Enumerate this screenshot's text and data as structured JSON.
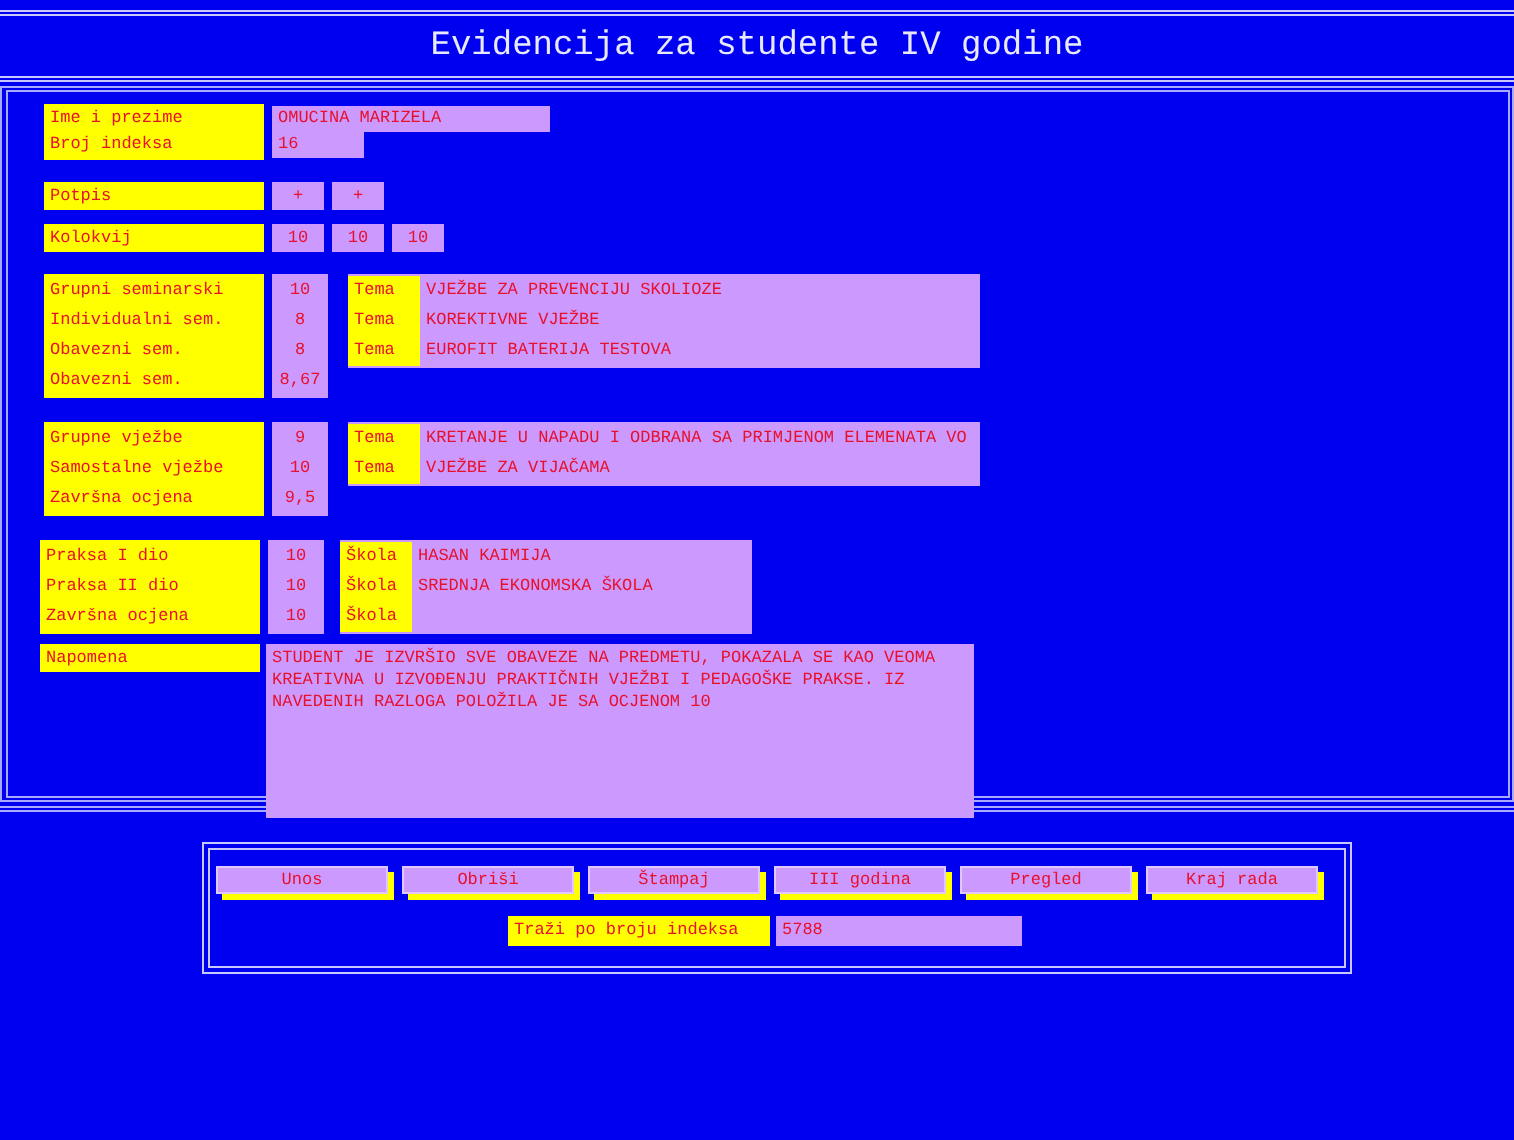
{
  "window": {
    "title": "Evidencija za studente IV godine"
  },
  "student": {
    "name_label": "Ime i prezime",
    "name": "OMUCINA MARIZELA",
    "index_label": "Broj indeksa",
    "index": "16"
  },
  "signature": {
    "label": "Potpis",
    "values": [
      "+",
      "+"
    ]
  },
  "colloquium": {
    "label": "Kolokvij",
    "values": [
      "10",
      "10",
      "10"
    ]
  },
  "seminars": {
    "rows": [
      {
        "label": "Grupni seminarski",
        "value": "10"
      },
      {
        "label": "Individualni sem.",
        "value": "8"
      },
      {
        "label": "Obavezni sem.",
        "value": "8"
      },
      {
        "label": "Obavezni sem.",
        "value": "8,67"
      }
    ],
    "topics": [
      {
        "label": "Tema",
        "value": "VJEŽBE ZA PREVENCIJU SKOLIOZE"
      },
      {
        "label": "Tema",
        "value": "KOREKTIVNE VJEŽBE"
      },
      {
        "label": "Tema",
        "value": "EUROFIT BATERIJA TESTOVA"
      }
    ]
  },
  "exercises": {
    "rows": [
      {
        "label": "Grupne vježbe",
        "value": "9"
      },
      {
        "label": "Samostalne vježbe",
        "value": "10"
      },
      {
        "label": "Završna ocjena",
        "value": "9,5"
      }
    ],
    "topics": [
      {
        "label": "Tema",
        "value": "KRETANJE U NAPADU I ODBRANA SA PRIMJENOM ELEMENATA VO"
      },
      {
        "label": "Tema",
        "value": "VJEŽBE ZA VIJAČAMA"
      }
    ]
  },
  "practice": {
    "rows": [
      {
        "label": "Praksa I dio",
        "value": "10"
      },
      {
        "label": "Praksa II dio",
        "value": "10"
      },
      {
        "label": "Završna ocjena",
        "value": "10"
      }
    ],
    "topics": [
      {
        "label": "Škola",
        "value": "HASAN KAIMIJA"
      },
      {
        "label": "Škola",
        "value": "SREDNJA EKONOMSKA ŠKOLA"
      },
      {
        "label": "Škola"
      }
    ]
  },
  "note": {
    "label": "Napomena",
    "text": "STUDENT JE IZVRŠIO SVE OBAVEZE NA PREDMETU, POKAZALA SE KAO VEOMA KREATIVNA U IZVOĐENJU PRAKTIČNIH VJEŽBI I PEDAGOŠKE PRAKSE. IZ NAVEDENIH RAZLOGA POLOŽILA JE SA OCJENOM 10"
  },
  "buttons": [
    "Unos",
    "Obriši",
    "Štampaj",
    "III godina",
    "Pregled",
    "Kraj rada"
  ],
  "search": {
    "label": "Traži po broju indeksa",
    "value": "5788"
  }
}
